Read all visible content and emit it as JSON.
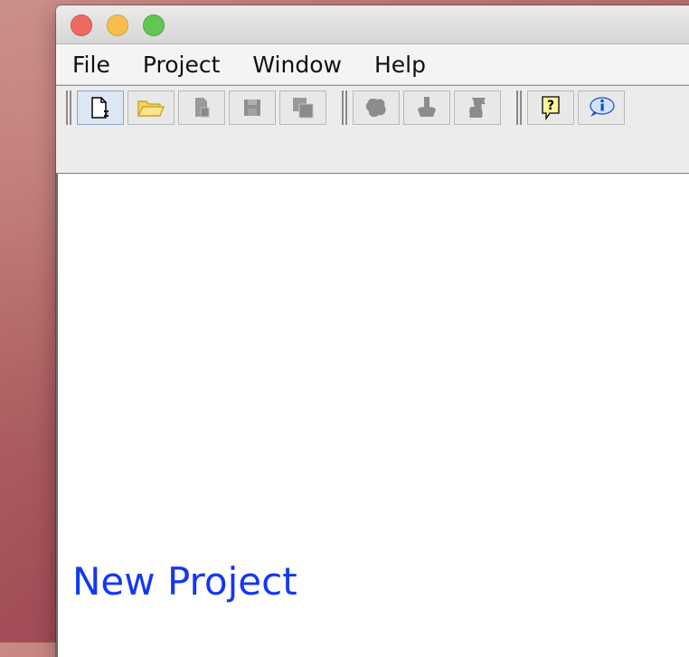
{
  "window": {
    "controls": [
      "close",
      "minimize",
      "zoom"
    ]
  },
  "menubar": {
    "items": [
      {
        "label": "File"
      },
      {
        "label": "Project"
      },
      {
        "label": "Window"
      },
      {
        "label": "Help"
      }
    ]
  },
  "toolbar": {
    "groups": [
      {
        "buttons": [
          {
            "icon": "new-file-icon",
            "enabled": true
          },
          {
            "icon": "open-folder-icon",
            "enabled": true
          },
          {
            "icon": "copy-file-icon",
            "enabled": false
          },
          {
            "icon": "save-disk-icon",
            "enabled": false
          },
          {
            "icon": "save-all-icon",
            "enabled": false
          }
        ]
      },
      {
        "buttons": [
          {
            "icon": "run-icon",
            "enabled": false
          },
          {
            "icon": "debug-icon",
            "enabled": false
          },
          {
            "icon": "script-icon",
            "enabled": false
          }
        ]
      },
      {
        "buttons": [
          {
            "icon": "help-icon",
            "enabled": true
          },
          {
            "icon": "info-icon",
            "enabled": true
          }
        ]
      }
    ]
  },
  "content": {
    "project_label": "New Project"
  },
  "colors": {
    "project_label": "#1438f0",
    "close": "#ee6a5f",
    "minimize": "#f5be4f",
    "zoom": "#62c554"
  }
}
